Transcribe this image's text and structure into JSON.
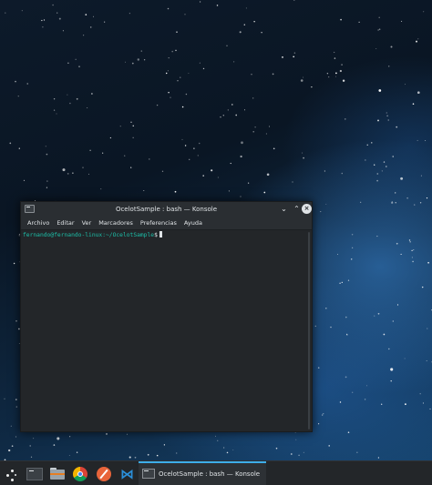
{
  "window": {
    "title": "OcelotSample : bash — Konsole",
    "app_icon": "terminal-icon",
    "controls": {
      "minimize_glyph": "⌄",
      "maximize_glyph": "⌃",
      "close_glyph": "×"
    }
  },
  "menubar": {
    "items": [
      "Archivo",
      "Editar",
      "Ver",
      "Marcadores",
      "Preferencias",
      "Ayuda"
    ]
  },
  "terminal": {
    "prompt_user": "fernando@fernando-linux:~/OcelotSample",
    "prompt_symbol": "$"
  },
  "taskbar": {
    "launchers": [
      {
        "name": "application-launcher-icon"
      },
      {
        "name": "konsole-launcher-icon"
      },
      {
        "name": "files-icon"
      },
      {
        "name": "chrome-icon"
      },
      {
        "name": "web-browser-icon"
      },
      {
        "name": "vscode-icon"
      }
    ],
    "active_task_label": "OcelotSample : bash — Konsole"
  },
  "colors": {
    "accent": "#3daee9",
    "prompt": "#1cbfa8",
    "window_bg": "#232629"
  }
}
